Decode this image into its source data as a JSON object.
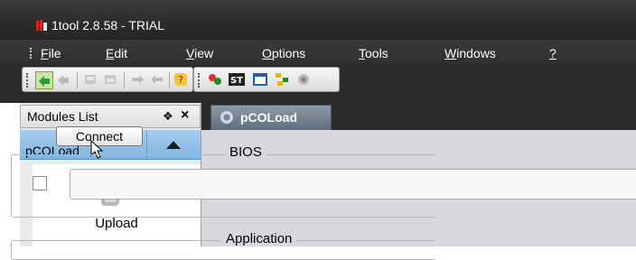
{
  "window": {
    "title": "1tool 2.8.58 - TRIAL"
  },
  "menu": {
    "items": [
      {
        "label": "File",
        "mnemonic": "F",
        "rest": "ile"
      },
      {
        "label": "Edit",
        "mnemonic": "E",
        "rest": "dit"
      },
      {
        "label": "View",
        "mnemonic": "V",
        "rest": "iew"
      },
      {
        "label": "Options",
        "mnemonic": "O",
        "rest": "ptions"
      },
      {
        "label": "Tools",
        "mnemonic": "T",
        "rest": "ools"
      },
      {
        "label": "Windows",
        "mnemonic": "W",
        "rest": "indows"
      },
      {
        "label": "?",
        "mnemonic": "?",
        "rest": ""
      }
    ]
  },
  "toolbar": {
    "buttons": [
      "connect-icon",
      "disconnect-icon",
      "upload-icon",
      "download-icon",
      "send-icon",
      "receive-icon",
      "help-icon",
      "tools-icon",
      "st-icon",
      "window-icon",
      "tree-icon",
      "plugin-icon"
    ]
  },
  "modules_panel": {
    "title": "Modules List",
    "pin_glyph": "❖",
    "close_glyph": "×",
    "selected_module": "pCOLoad",
    "collapse_glyph": "▲",
    "module_item_label": "Upload"
  },
  "tooltip": {
    "text": "Connect"
  },
  "tab": {
    "label": "pCOLoad"
  },
  "content": {
    "bios_label": "BIOS",
    "application_label": "Application",
    "bios_checked": false,
    "bios_path": ""
  }
}
